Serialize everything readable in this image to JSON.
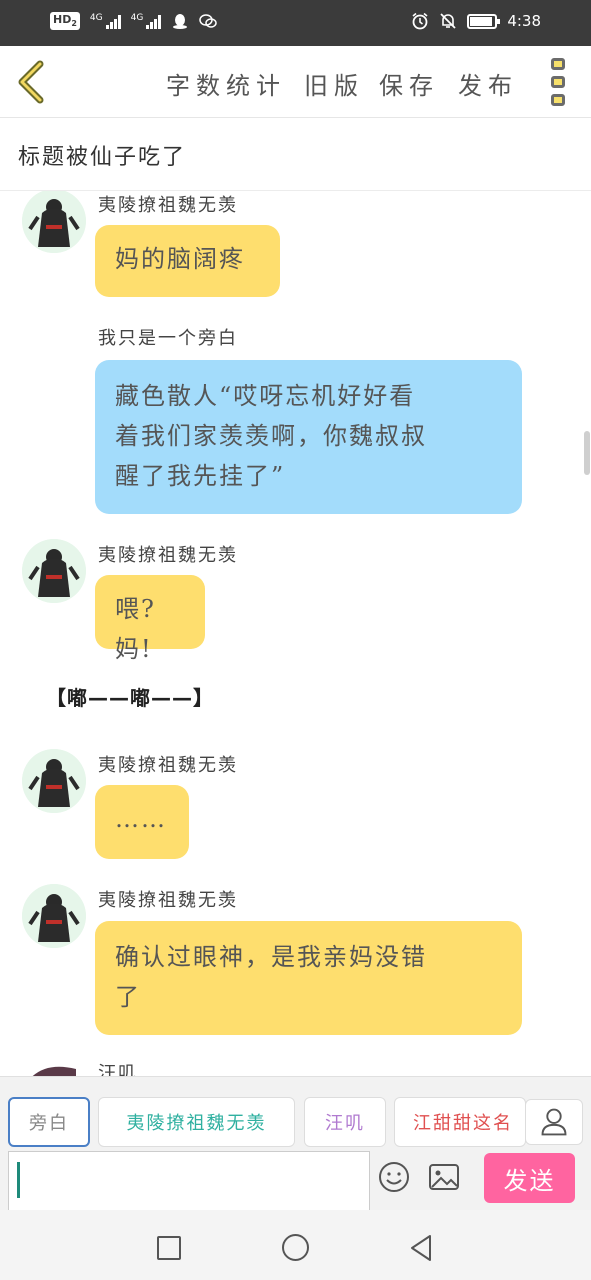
{
  "status_bar": {
    "left": {
      "hd": "HD",
      "hd_sub": "2",
      "sim1": "4G",
      "sim2": "4G"
    },
    "icons": [
      "hd-icon",
      "signal-icon",
      "signal-icon",
      "qq-icon",
      "wechat-icon",
      "alarm-icon",
      "mute-icon",
      "battery-icon"
    ],
    "time": "4:38"
  },
  "header": {
    "back_icon": "chevron-left-icon",
    "word_count": "字数统计",
    "old_version": "旧版",
    "save": "保存",
    "publish": "发布",
    "menu_icon": "menu-icon"
  },
  "title": "标题被仙子吃了",
  "messages": [
    {
      "type": "character",
      "name": "夷陵撩祖魏无羡",
      "text": "妈的脑阔疼",
      "color": "yellow"
    },
    {
      "type": "narration",
      "name": "我只是一个旁白",
      "lines": [
        "藏色散人“哎呀忘机好好看",
        "着我们家羡羡啊，你魏叔叔",
        "醒了我先挂了”"
      ],
      "color": "blue"
    },
    {
      "type": "character",
      "name": "夷陵撩祖魏无羡",
      "text": "喂?妈!",
      "color": "yellow"
    },
    {
      "type": "system",
      "text": "【嘟——嘟——】"
    },
    {
      "type": "character",
      "name": "夷陵撩祖魏无羡",
      "text": "……",
      "color": "yellow"
    },
    {
      "type": "character",
      "name": "夷陵撩祖魏无羡",
      "lines": [
        "确认过眼神，是我亲妈没错",
        "了"
      ],
      "color": "yellow"
    },
    {
      "type": "character",
      "name": "汪叽",
      "text": ""
    }
  ],
  "roles": [
    {
      "label": "旁白",
      "color": "#888888",
      "active": true
    },
    {
      "label": "夷陵撩祖魏无羡",
      "color": "#2fb0a0",
      "active": false
    },
    {
      "label": "汪叽",
      "color": "#b07ad0",
      "active": false
    },
    {
      "label": "江甜甜这名",
      "color": "#e05050",
      "active": false
    }
  ],
  "composer": {
    "user_icon": "user-icon",
    "emoji_icon": "smile-icon",
    "image_icon": "image-icon",
    "send": "发送"
  },
  "nav": [
    "recent-apps-icon",
    "home-icon",
    "back-icon"
  ],
  "colors": {
    "bubble_yellow": "#fede6e",
    "bubble_blue": "#a3dcfb",
    "send": "#ff64a0",
    "status_bar": "#3b3b3b"
  }
}
